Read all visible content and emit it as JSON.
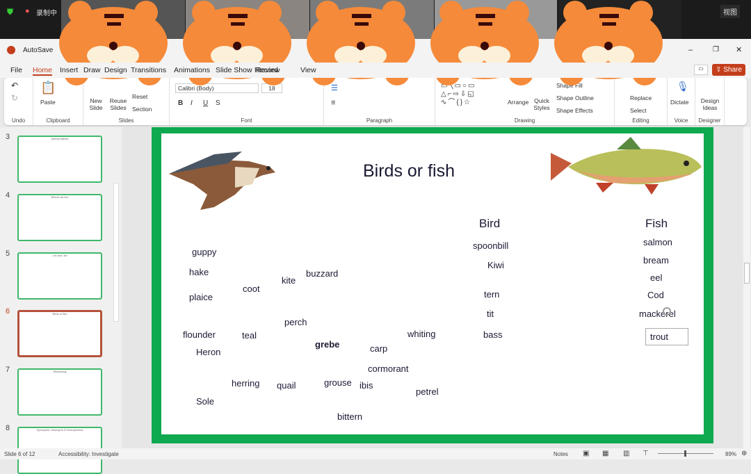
{
  "meeting": {
    "recording": "录制中",
    "view": "视图"
  },
  "app": {
    "autosave": "AutoSave",
    "share": "Share"
  },
  "tabs": [
    "File",
    "Home",
    "Insert",
    "Draw",
    "Design",
    "Transitions",
    "Animations",
    "Slide Show",
    "Record",
    "Review",
    "View"
  ],
  "ribbon": {
    "undo": "Undo",
    "clipboard": "Clipboard",
    "paste": "Paste",
    "slides": "Slides",
    "new_slide": "New Slide",
    "reuse_slides": "Reuse Slides",
    "reset": "Reset",
    "section": "Section",
    "font": "Font",
    "font_name": "Calibri (Body)",
    "font_size": "18",
    "paragraph": "Paragraph",
    "drawing": "Drawing",
    "arrange": "Arrange",
    "quick_styles": "Quick Styles",
    "shape_fill": "Shape Fill",
    "shape_outline": "Shape Outline",
    "shape_effects": "Shape Effects",
    "editing": "Editing",
    "replace": "Replace",
    "select": "Select",
    "voice": "Voice",
    "dictate": "Dictate",
    "designer": "Designer",
    "design_ideas": "Design Ideas"
  },
  "thumbnails": [
    {
      "num": "3",
      "title": "Animal babies"
    },
    {
      "num": "4",
      "title": "Where we live"
    },
    {
      "num": "5",
      "title": "-ics and -ise"
    },
    {
      "num": "6",
      "title": "Birds or fish"
    },
    {
      "num": "7",
      "title": "Measuring"
    },
    {
      "num": "8",
      "title": "Synonyms, Antonyms & Homophones"
    }
  ],
  "slide": {
    "title": "Birds or fish",
    "bird_heading": "Bird",
    "fish_heading": "Fish",
    "loose_words": [
      "guppy",
      "hake",
      "kite",
      "buzzard",
      "coot",
      "plaice",
      "perch",
      "flounder",
      "teal",
      "grebe",
      "carp",
      "whiting",
      "Heron",
      "cormorant",
      "herring",
      "quail",
      "grouse",
      "ibis",
      "petrel",
      "Sole",
      "bittern"
    ],
    "bird_words": [
      "spoonbill",
      "Kiwi",
      "tern",
      "tit",
      "bass"
    ],
    "fish_words": [
      "salmon",
      "bream",
      "eel",
      "Cod",
      "mackerel",
      "trout"
    ]
  },
  "status": {
    "slide": "Slide 6 of 12",
    "accessibility": "Accessibility: Investigate",
    "notes": "Notes",
    "zoom": "89%"
  },
  "colors": {
    "accent": "#c43e1c",
    "slide_border": "#0fa950",
    "selected_thumb": "#b5523b"
  }
}
